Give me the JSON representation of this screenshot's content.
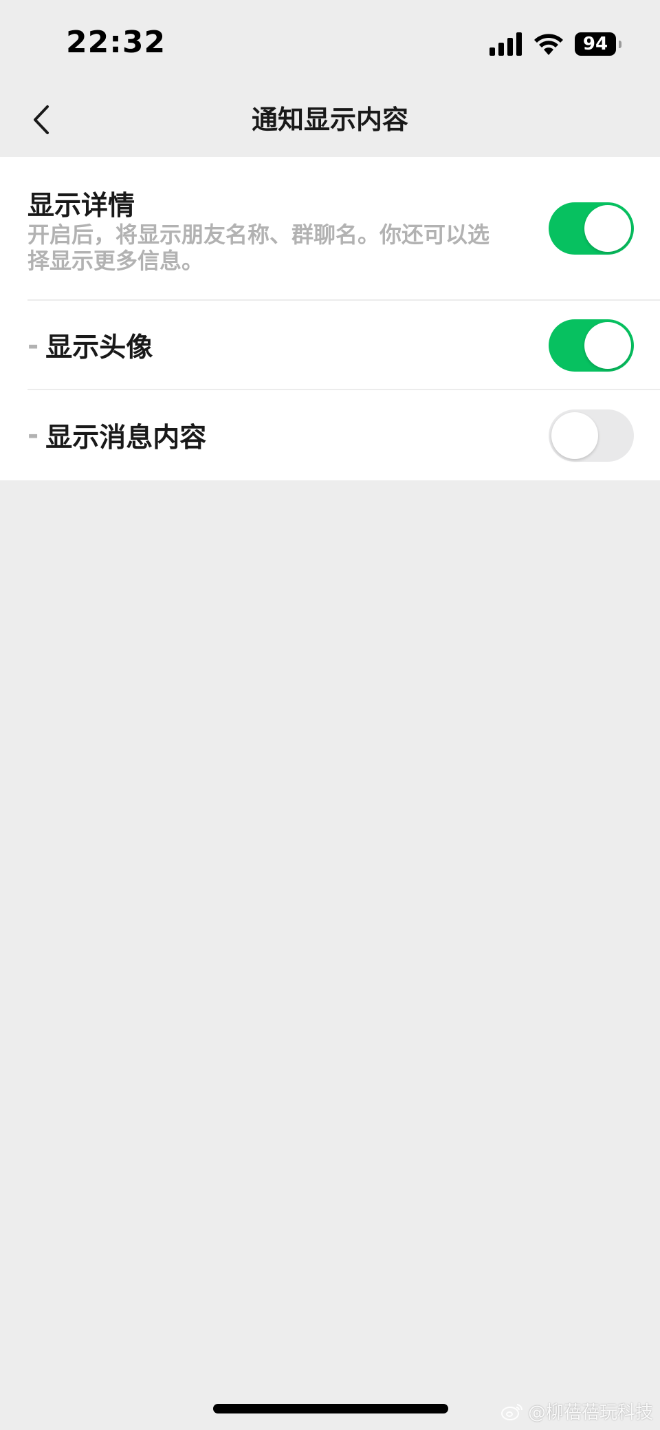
{
  "status_bar": {
    "time": "22:32",
    "battery": "94",
    "icons": [
      "signal-icon",
      "wifi-icon",
      "battery-icon"
    ]
  },
  "nav": {
    "title": "通知显示内容",
    "back_icon": "chevron-left-icon"
  },
  "settings": {
    "show_details": {
      "title": "显示详情",
      "description": "开启后，将显示朋友名称、群聊名。你还可以选择显示更多信息。",
      "enabled": true
    },
    "show_avatar": {
      "prefix": "-",
      "label": "显示头像",
      "enabled": true
    },
    "show_message_content": {
      "prefix": "-",
      "label": "显示消息内容",
      "enabled": false
    }
  },
  "colors": {
    "toggle_on": "#07c160",
    "toggle_off": "#e9e9ea",
    "background": "#ededed",
    "secondary_text": "#b2b2b2"
  },
  "watermark": {
    "text": "@柳蓓蓓玩科技",
    "icon": "weibo-logo-icon"
  }
}
